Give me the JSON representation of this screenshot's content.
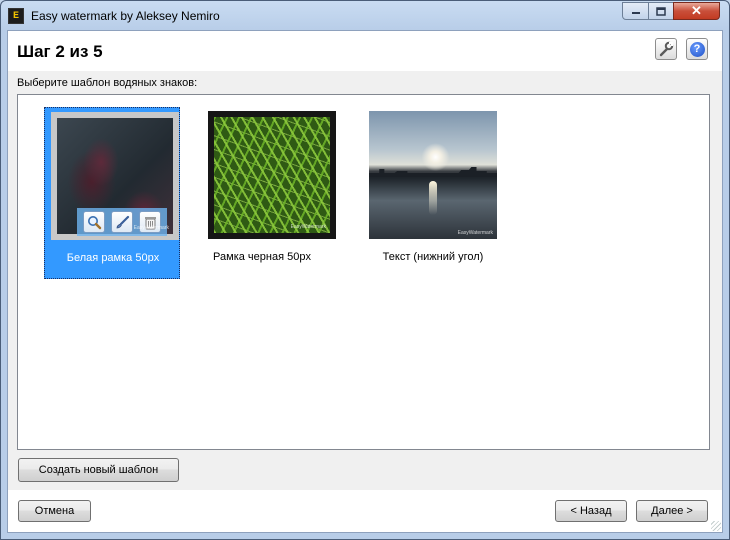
{
  "window": {
    "title": "Easy watermark by Aleksey Nemiro",
    "icon_text": "E",
    "close_glyph": "✕"
  },
  "header": {
    "step_title": "Шаг 2 из 5",
    "settings_icon": "wrench-icon",
    "help_icon": "question-icon",
    "help_glyph": "?"
  },
  "prompt": "Выберите шаблон водяных знаков:",
  "templates": [
    {
      "label": "Белая рамка 50px",
      "selected": true,
      "watermark": "EasyWatermark"
    },
    {
      "label": "Рамка черная 50px",
      "selected": false,
      "watermark": "EasyWatermark"
    },
    {
      "label": "Текст (нижний угол)",
      "selected": false,
      "watermark": "EasyWatermark"
    }
  ],
  "tile_actions": [
    "search-icon",
    "brush-icon",
    "trash-icon"
  ],
  "buttons": {
    "create": "Создать новый шаблон",
    "cancel": "Отмена",
    "back": "< Назад",
    "next": "Далее >"
  },
  "colors": {
    "selection": "#3399ff",
    "accent": "#1d4fc4"
  }
}
